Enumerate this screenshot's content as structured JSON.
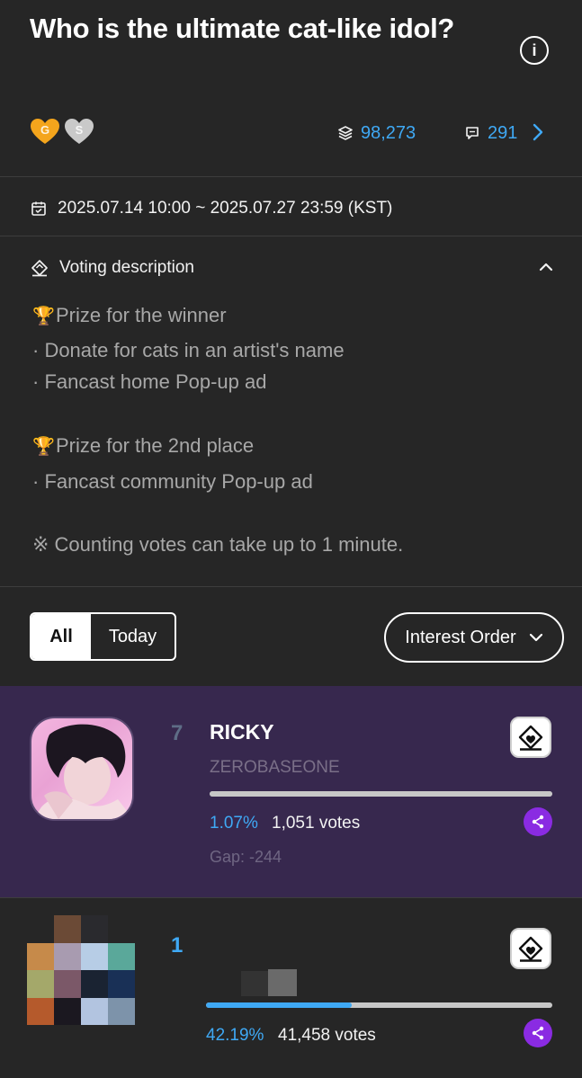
{
  "poll": {
    "title": "Who is the ultimate cat-like idol?",
    "hearts": [
      "G",
      "S"
    ],
    "participants": "98,273",
    "comments": "291",
    "period": "2025.07.14 10:00 ~ 2025.07.27 23:59 (KST)"
  },
  "description": {
    "label": "Voting description",
    "prize1_title": "Prize for the winner",
    "prize1_items": [
      "·  Donate for cats in an artist's name",
      "·  Fancast home Pop-up ad"
    ],
    "prize2_title": "Prize for the 2nd place",
    "prize2_items": [
      "·  Fancast community Pop-up ad"
    ],
    "note": "※ Counting votes can take up to 1 minute."
  },
  "filters": {
    "all": "All",
    "today": "Today",
    "sort": "Interest Order"
  },
  "my_pick": {
    "rank": "7",
    "name": "RICKY",
    "group": "ZEROBASEONE",
    "percent_text": "1.07%",
    "votes_text": "1,051 votes",
    "gap_text": "Gap: -244",
    "bar_fraction": 1.0
  },
  "leader": {
    "rank": "1",
    "percent_text": "42.19%",
    "votes_text": "41,458 votes",
    "bar_fraction": 0.42
  },
  "colors": {
    "accent": "#3fa9f5",
    "highlight_bg": "#37284e",
    "share": "#8a2be2",
    "rank_muted": "#5e6d86",
    "rank_top": "#3fa9f5"
  }
}
